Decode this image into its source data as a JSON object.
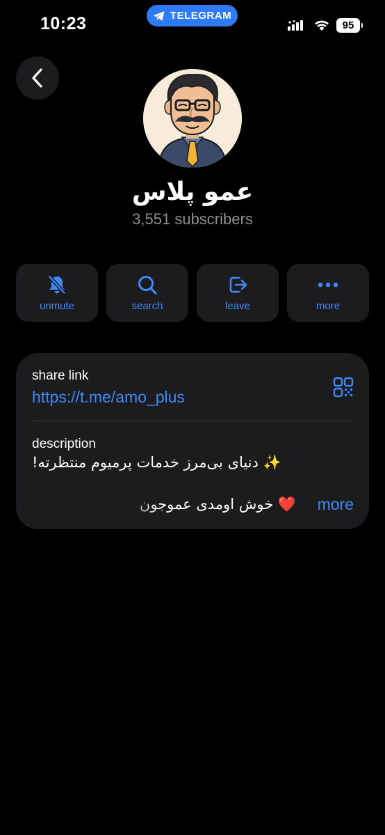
{
  "status": {
    "time": "10:23",
    "app_pill": "TELEGRAM",
    "battery": "95"
  },
  "profile": {
    "name": "عمو پلاس",
    "subscribers": "3,551 subscribers"
  },
  "actions": [
    {
      "label": "unmute",
      "icon": "bell-slash-icon"
    },
    {
      "label": "search",
      "icon": "search-icon"
    },
    {
      "label": "leave",
      "icon": "leave-icon"
    },
    {
      "label": "more",
      "icon": "ellipsis-icon"
    }
  ],
  "info": {
    "share_label": "share link",
    "share_url": "https://t.me/amo_plus",
    "description_label": "description",
    "description_line1": "✨ دنیای بی‌مرز خدمات پرمیوم منتظرته!",
    "description_line2": "❤️ خوش اومدی عموجون",
    "more": "more"
  },
  "colors": {
    "accent": "#3e88f7",
    "card": "#1c1c1e",
    "pill": "#2f7bf5"
  }
}
